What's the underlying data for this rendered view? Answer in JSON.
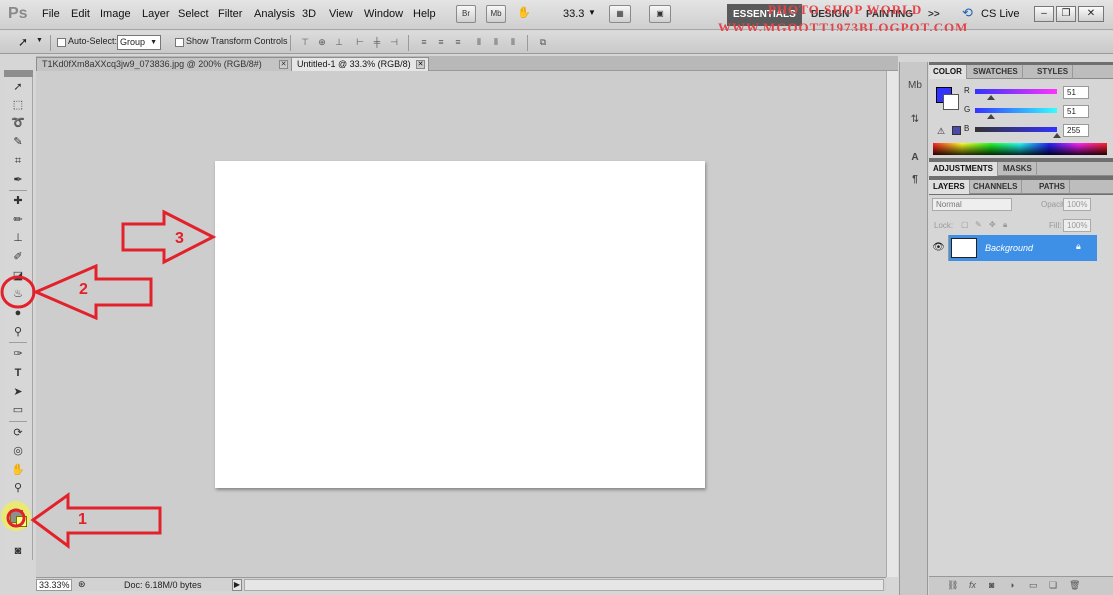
{
  "app": {
    "logo": "Ps"
  },
  "menu": [
    "File",
    "Edit",
    "Image",
    "Layer",
    "Select",
    "Filter",
    "Analysis",
    "3D",
    "View",
    "Window",
    "Help"
  ],
  "menubar_buttons": {
    "bridge": "Br",
    "mini_bridge": "Mb",
    "zoom": "33.3"
  },
  "workspace": {
    "essentials": "ESSENTIALS",
    "design": "DESIGN",
    "painting": "PAINTING",
    "more": ">>",
    "cs_live": "CS Live"
  },
  "watermark": {
    "line1": "PHOTO SHOP WORLD",
    "line2": "WWW.MGOOTT1973BLOGPOT.COM"
  },
  "options": {
    "auto_select": "Auto-Select:",
    "group": "Group",
    "transform": "Show Transform Controls"
  },
  "tabs": [
    {
      "label": "T1Kd0fXm8aXXcq3jw9_073836.jpg @ 200% (RGB/8#)"
    },
    {
      "label": "Untitled-1 @ 33.3% (RGB/8)"
    }
  ],
  "status": {
    "zoom": "33.33%",
    "doc": "Doc: 6.18M/0 bytes"
  },
  "color_panel": {
    "tabs": [
      "COLOR",
      "SWATCHES",
      "STYLES"
    ],
    "r": {
      "label": "R",
      "value": "51"
    },
    "g": {
      "label": "G",
      "value": "51"
    },
    "b": {
      "label": "B",
      "value": "255"
    },
    "foreground": "#3333ff"
  },
  "adjust_panel": {
    "tabs": [
      "ADJUSTMENTS",
      "MASKS"
    ]
  },
  "layers_panel": {
    "tabs": [
      "LAYERS",
      "CHANNELS",
      "PATHS"
    ],
    "blend": "Normal",
    "opacity_label": "Opacity:",
    "opacity": "100%",
    "lock_label": "Lock:",
    "fill_label": "Fill:",
    "fill": "100%",
    "layer_name": "Background"
  },
  "annotations": {
    "a1": "1",
    "a2": "2",
    "a3": "3",
    "color": "#e3212a"
  }
}
